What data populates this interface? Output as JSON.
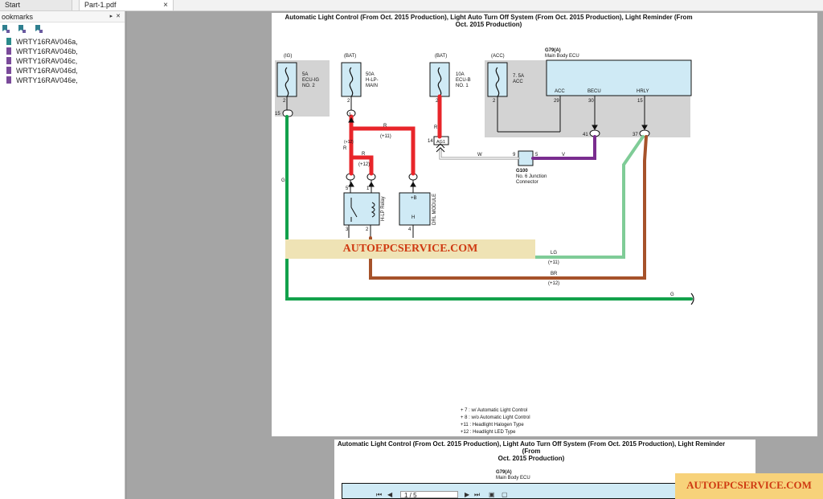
{
  "tabs": [
    {
      "label": "Start"
    },
    {
      "label": "Part-1.pdf",
      "close": "×"
    }
  ],
  "sidebar": {
    "title": "ookmarks",
    "controls": "▸ ✕",
    "items": [
      {
        "label": "WRTY16RAV046a,"
      },
      {
        "label": "WRTY16RAV046b,"
      },
      {
        "label": "WRTY16RAV046c,"
      },
      {
        "label": "WRTY16RAV046d,"
      },
      {
        "label": "WRTY16RAV046e,"
      }
    ]
  },
  "page1": {
    "title_line1": "Automatic Light Control (From Oct. 2015 Production), Light Auto Turn Off System (From Oct. 2015 Production), Light Reminder (From",
    "title_line2": "Oct. 2015 Production)"
  },
  "page2": {
    "title_line1": "Automatic Light Control (From Oct. 2015 Production), Light Auto Turn Off System (From Oct. 2015 Production), Light Reminder (From",
    "title_line2": "Oct. 2015 Production)",
    "g79": "G79(A)",
    "g79_name": "Main Body ECU"
  },
  "diagram": {
    "ig_label": "(IG)",
    "bat1_label": "(BAT)",
    "bat2_label": "(BAT)",
    "acc_label": "(ACC)",
    "fuse_ig": [
      "5A",
      "ECU-IG",
      "NO. 2"
    ],
    "fuse_hlp": [
      "50A",
      "H-LP-",
      "MAIN"
    ],
    "fuse_ecub": [
      "10A",
      "ECU-B",
      "NO. 1"
    ],
    "fuse_acc": [
      "7. 5A",
      "ACC"
    ],
    "ecu_id": "G79(A)",
    "ecu_name": "Main Body ECU",
    "pin_acc": "ACC",
    "pin_becu": "BECU",
    "pin_hrly": "HRLY",
    "n2a": "2",
    "n2b": "2",
    "n2c": "2",
    "n2d": "2",
    "n15": "15",
    "n29": "29",
    "n30": "30",
    "n15b": "15",
    "n41": "41",
    "n37": "37",
    "n14": "14",
    "n9": "9",
    "n5": "5",
    "n5b": "5",
    "n1": "1",
    "n3": "3",
    "n2e": "2",
    "n4": "4",
    "conn_1": "1",
    "conn_ag1": "AG1",
    "w_r1": "R",
    "w_r1s": "(+11)",
    "w_r2": "R",
    "w_r2s": "(+12)",
    "w_r3": "R",
    "w_w": "W",
    "w_v": "V",
    "w_g": "G",
    "w_lg": "LG",
    "w_lg_s": "(+11)",
    "w_br": "BR",
    "w_br_s": "(+12)",
    "w_g2": "G",
    "w_r4": "R",
    "w_r4s": "(+12)",
    "g100": "G100",
    "g100_name1": "No. 6 Junction",
    "g100_name2": "Connector",
    "relay": "H-LP Relay",
    "drl": "DRL MODULE",
    "drl_b": "+B",
    "drl_h": "H"
  },
  "legend": [
    "+ 7 : w/ Automatic Light Control",
    "+ 8 : w/o Automatic Light Control",
    "+11 : Headlight Halogen Type",
    "+12 : Headlight LED Type"
  ],
  "watermark": "AUTOEPCSERVICE.COM",
  "watermark2": "AUTOEPCSERVICE.COM",
  "nav": {
    "page": "1 / 5"
  },
  "colors": {
    "red": "#e8252a",
    "green": "#12a14b",
    "lightgreen": "#7fcc97",
    "brown": "#a6522a",
    "violet": "#7a2d8f"
  }
}
